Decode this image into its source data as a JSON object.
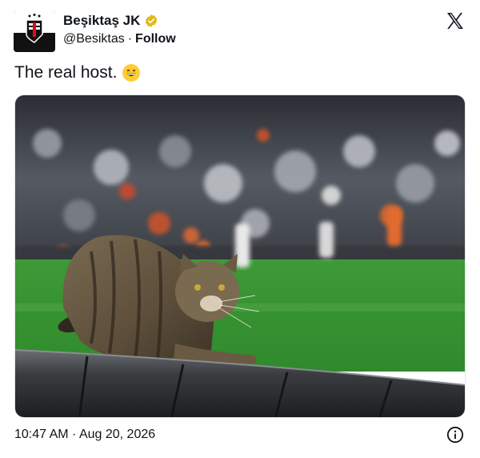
{
  "author": {
    "name": "Beşiktaş JK",
    "handle": "@Besiktas",
    "separator": "·",
    "follow_label": "Follow",
    "avatar_icon": "besiktas-crest-icon",
    "verified_icon": "gold-verified-badge-icon",
    "verified_color": "#e2b719"
  },
  "header": {
    "platform_icon": "x-logo-icon"
  },
  "tweet": {
    "text": "The real host.",
    "emoji_icon": "grinning-face-emoji-icon"
  },
  "media": {
    "description_icon": "photo-cat-on-stadium-barrier"
  },
  "footer": {
    "timestamp": "10:47 AM · Aug 20, 2026",
    "info_icon": "info-icon"
  },
  "colors": {
    "text": "#0f1419",
    "pitch_green": "#3f9a3a"
  }
}
